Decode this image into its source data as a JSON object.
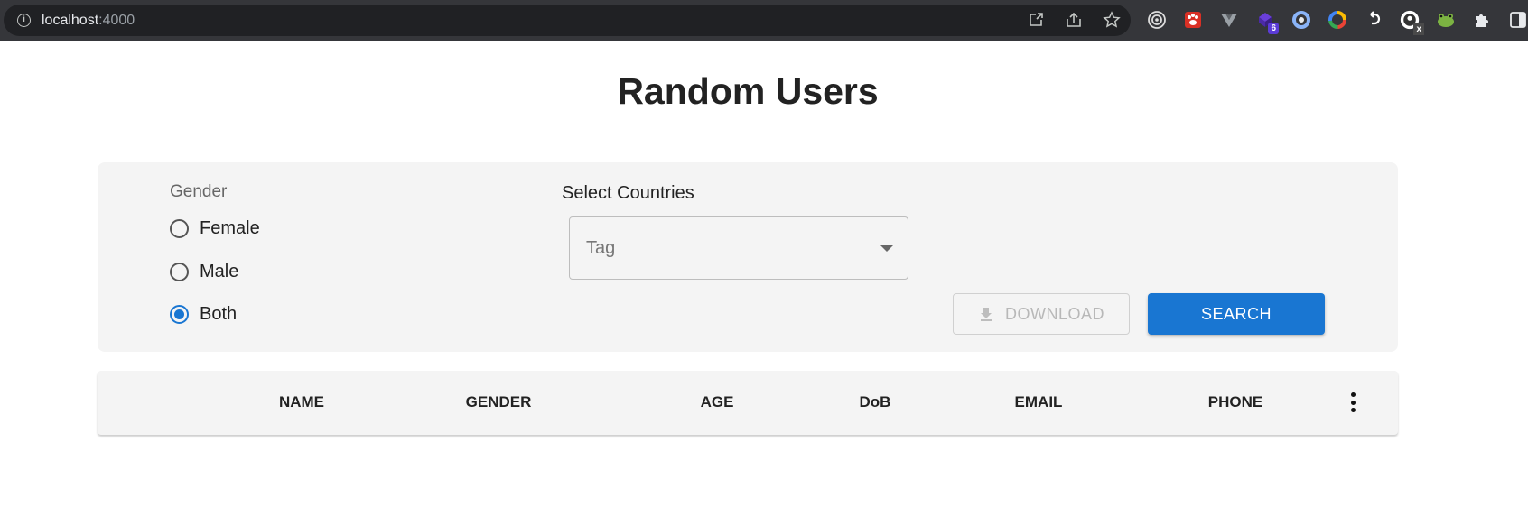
{
  "browser": {
    "url_host": "localhost",
    "url_port": ":4000",
    "extension_badges": {
      "purple_ext": "6",
      "avatar_ext": "x"
    }
  },
  "page": {
    "title": "Random Users"
  },
  "filters": {
    "gender_label": "Gender",
    "gender_options": [
      {
        "label": "Female",
        "checked": false
      },
      {
        "label": "Male",
        "checked": false
      },
      {
        "label": "Both",
        "checked": true
      }
    ],
    "countries_label": "Select Countries",
    "countries_placeholder": "Tag",
    "download_label": "DOWNLOAD",
    "search_label": "SEARCH"
  },
  "table": {
    "columns": [
      "NAME",
      "GENDER",
      "AGE",
      "DoB",
      "EMAIL",
      "PHONE"
    ]
  },
  "colors": {
    "accent": "#1976d2",
    "panel_bg": "#f4f4f4",
    "chrome_bg": "#35363a"
  }
}
